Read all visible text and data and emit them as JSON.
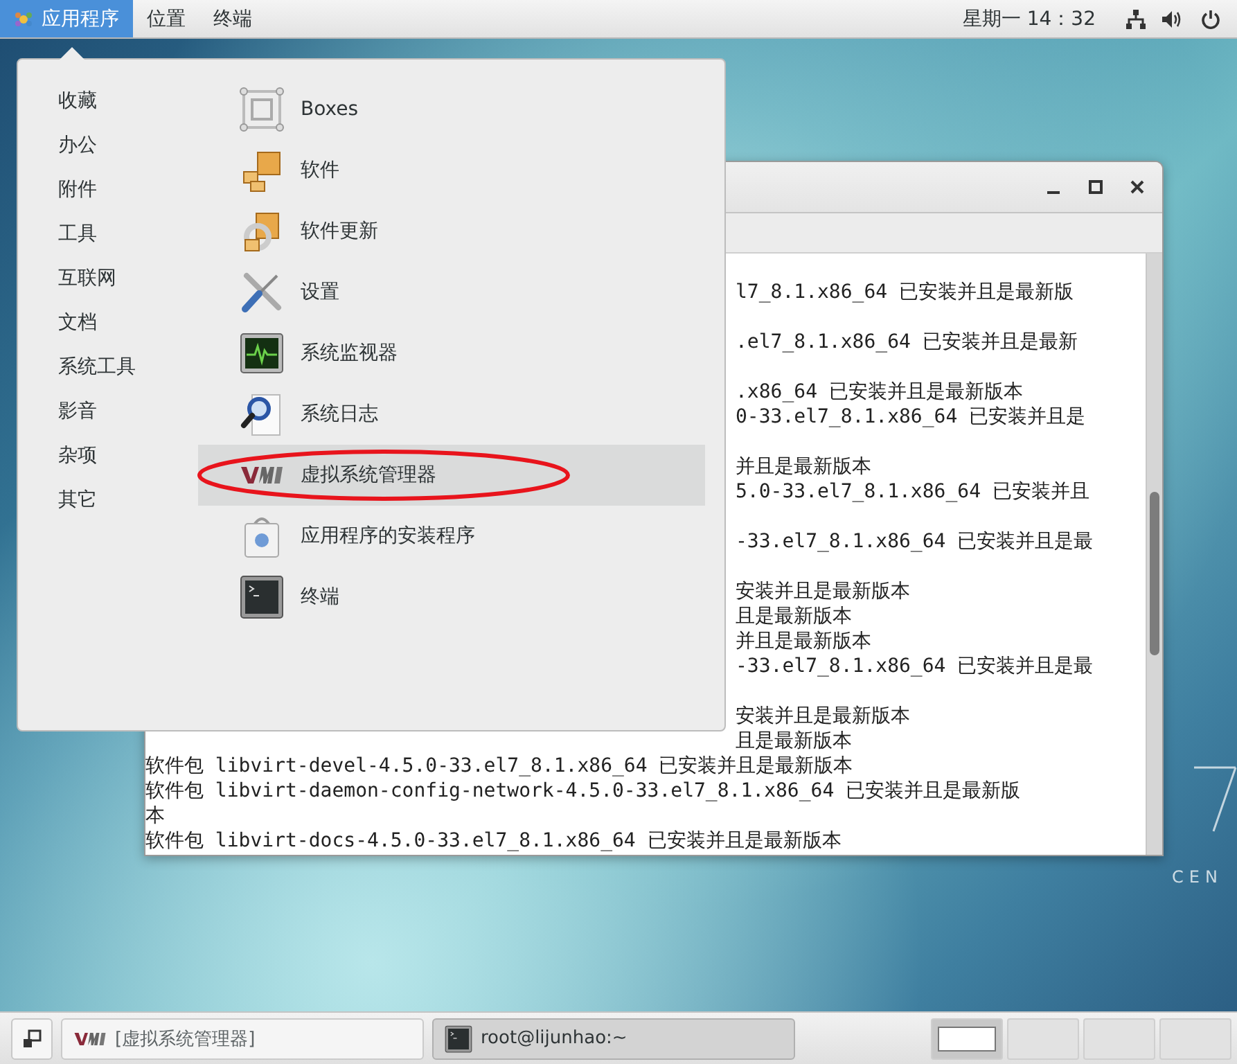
{
  "top_bar": {
    "menus": [
      {
        "label": "应用程序",
        "selected": true
      },
      {
        "label": "位置",
        "selected": false
      },
      {
        "label": "终端",
        "selected": false
      }
    ],
    "clock": "星期一 14：32"
  },
  "terminal_window": {
    "lines": [
      {
        "kind": "covered"
      },
      {
        "kind": "partial",
        "text": "l7_8.1.x86_64 已安装并且是最新版"
      },
      {
        "kind": "covered"
      },
      {
        "kind": "partial",
        "text": ".el7_8.1.x86_64 已安装并且是最新"
      },
      {
        "kind": "covered"
      },
      {
        "kind": "partial",
        "text": ".x86_64 已安装并且是最新版本"
      },
      {
        "kind": "partial",
        "text": "0-33.el7_8.1.x86_64 已安装并且是"
      },
      {
        "kind": "covered"
      },
      {
        "kind": "partial",
        "text": "并且是最新版本"
      },
      {
        "kind": "partial",
        "text": "5.0-33.el7_8.1.x86_64 已安装并且"
      },
      {
        "kind": "covered"
      },
      {
        "kind": "partial",
        "text": "-33.el7_8.1.x86_64 已安装并且是最"
      },
      {
        "kind": "covered"
      },
      {
        "kind": "partial",
        "text": "安装并且是最新版本"
      },
      {
        "kind": "partial",
        "text": "且是最新版本"
      },
      {
        "kind": "partial",
        "text": "并且是最新版本"
      },
      {
        "kind": "partial",
        "text": "-33.el7_8.1.x86_64 已安装并且是最"
      },
      {
        "kind": "covered"
      },
      {
        "kind": "partial",
        "text": "安装并且是最新版本"
      },
      {
        "kind": "partial",
        "text": "且是最新版本"
      },
      {
        "kind": "full",
        "text": "软件包 libvirt-devel-4.5.0-33.el7_8.1.x86_64 已安装并且是最新版本"
      },
      {
        "kind": "full",
        "text": "软件包 libvirt-daemon-config-network-4.5.0-33.el7_8.1.x86_64 已安装并且是最新版"
      },
      {
        "kind": "full",
        "text": "本"
      },
      {
        "kind": "full",
        "text": "软件包 libvirt-docs-4.5.0-33.el7_8.1.x86_64 已安装并且是最新版本"
      }
    ]
  },
  "app_menu": {
    "categories": [
      {
        "label": "收藏"
      },
      {
        "label": "办公"
      },
      {
        "label": "附件"
      },
      {
        "label": "工具"
      },
      {
        "label": "互联网"
      },
      {
        "label": "文档"
      },
      {
        "label": "系统工具"
      },
      {
        "label": "影音"
      },
      {
        "label": "杂项"
      },
      {
        "label": "其它"
      }
    ],
    "apps": [
      {
        "label": "Boxes",
        "kind": "boxes",
        "selected": false,
        "annotated": false
      },
      {
        "label": "软件",
        "kind": "packages",
        "selected": false,
        "annotated": false
      },
      {
        "label": "软件更新",
        "kind": "update",
        "selected": false,
        "annotated": false
      },
      {
        "label": "设置",
        "kind": "tools",
        "selected": false,
        "annotated": false
      },
      {
        "label": "系统监视器",
        "kind": "monitor",
        "selected": false,
        "annotated": false
      },
      {
        "label": "系统日志",
        "kind": "log",
        "selected": false,
        "annotated": false
      },
      {
        "label": "虚拟系统管理器",
        "kind": "vmm",
        "selected": true,
        "annotated": true
      },
      {
        "label": "应用程序的安装程序",
        "kind": "bag",
        "selected": false,
        "annotated": false
      },
      {
        "label": "终端",
        "kind": "terminal",
        "selected": false,
        "annotated": false
      }
    ]
  },
  "taskbar": {
    "windows": [
      {
        "label": "[虚拟系统管理器]",
        "kind": "vmm",
        "selected": false
      },
      {
        "label": "root@lijunhao:~",
        "kind": "terminal",
        "selected": true
      }
    ],
    "workspaces": [
      {
        "selected": true
      },
      {
        "selected": false
      },
      {
        "selected": false
      },
      {
        "selected": false
      }
    ]
  },
  "desktop": {
    "logo_text": "CEN"
  }
}
